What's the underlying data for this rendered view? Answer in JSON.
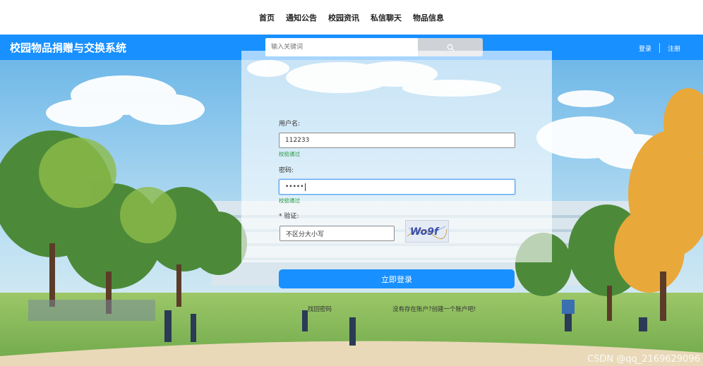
{
  "nav": {
    "items": [
      "首页",
      "通知公告",
      "校园资讯",
      "私信聊天",
      "物品信息"
    ]
  },
  "header": {
    "brand": "校园物品捐赠与交换系统",
    "search_placeholder": "输入关键词",
    "login": "登录",
    "register": "注册"
  },
  "form": {
    "username_label": "用户名:",
    "username_value": "112233",
    "username_ok": "校验通过",
    "password_label": "密码:",
    "password_value": "•••••",
    "password_ok": "校验通过",
    "captcha_label": "* 验证:",
    "captcha_placeholder": "不区分大小写",
    "captcha_text": "Wo9f",
    "submit": "立即登录",
    "forgot": "找回密码",
    "signup": "没有存在账户?创建一个账户吧!"
  },
  "watermark": "CSDN @qq_2169629096",
  "colors": {
    "primary": "#1890ff",
    "valid": "#23963a"
  }
}
